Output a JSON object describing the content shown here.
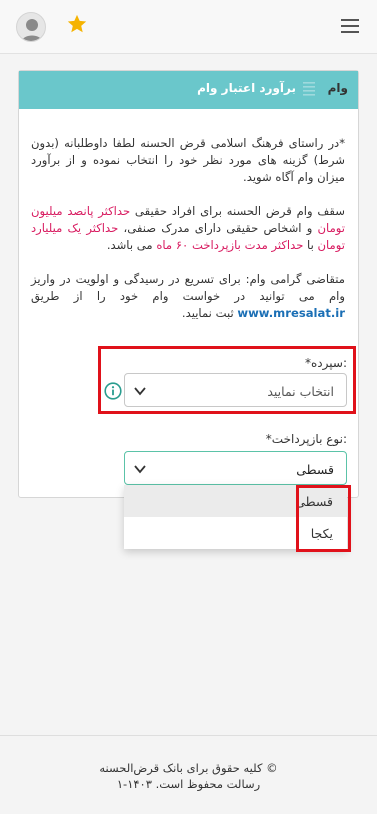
{
  "header": {
    "avatar_icon": "user-avatar-icon",
    "star_icon": "star-icon",
    "menu_icon": "hamburger-menu-icon"
  },
  "card": {
    "header_vam": "وام",
    "header_title": "برآورد اعتبار وام",
    "p1": "*در راستای فرهنگ اسلامی قرض الحسنه لطفا داوطلبانه (بدون شرط) گزینه های مورد نظر خود را انتخاب نموده و از برآورد میزان وام آگاه شوید.",
    "p2_a": "سقف وام قرض الحسنه برای افراد حقیقی ",
    "p2_hl1": "حداکثر پانصد میلیون تومان",
    "p2_b": " و اشخاص حقیقی دارای مدرک صنفی، ",
    "p2_hl2": "حداکثر یک میلیارد تومان",
    "p2_c": " با ",
    "p2_hl3": "حداکثر مدت بازپرداخت ۶۰ ماه",
    "p2_d": " می باشد.",
    "p3_a": "متقاضی گرامی وام: برای تسریع در رسیدگی و اولویت در واریز وام می توانید در خواست وام خود را از طریق ",
    "p3_link": "www.mresalat.ir",
    "p3_b": " ثبت نمایید."
  },
  "form": {
    "deposit_label": "*سپرده:",
    "deposit_value": "انتخاب نمایید",
    "repayment_label": "*نوع بازپرداخت:",
    "repayment_value": "قسطی",
    "options": [
      "قسطی",
      "یکجا"
    ]
  },
  "footer": {
    "line1": "© کلیه حقوق برای بانک قرض‌الحسنه",
    "line2": "رسالت محفوظ است. ۱۴۰۳-۱"
  },
  "colors": {
    "header_teal": "#6ac7cb",
    "highlight": "#d81b60",
    "link": "#1b6fb5",
    "red_box": "#e0111a",
    "star": "#f5b301"
  }
}
